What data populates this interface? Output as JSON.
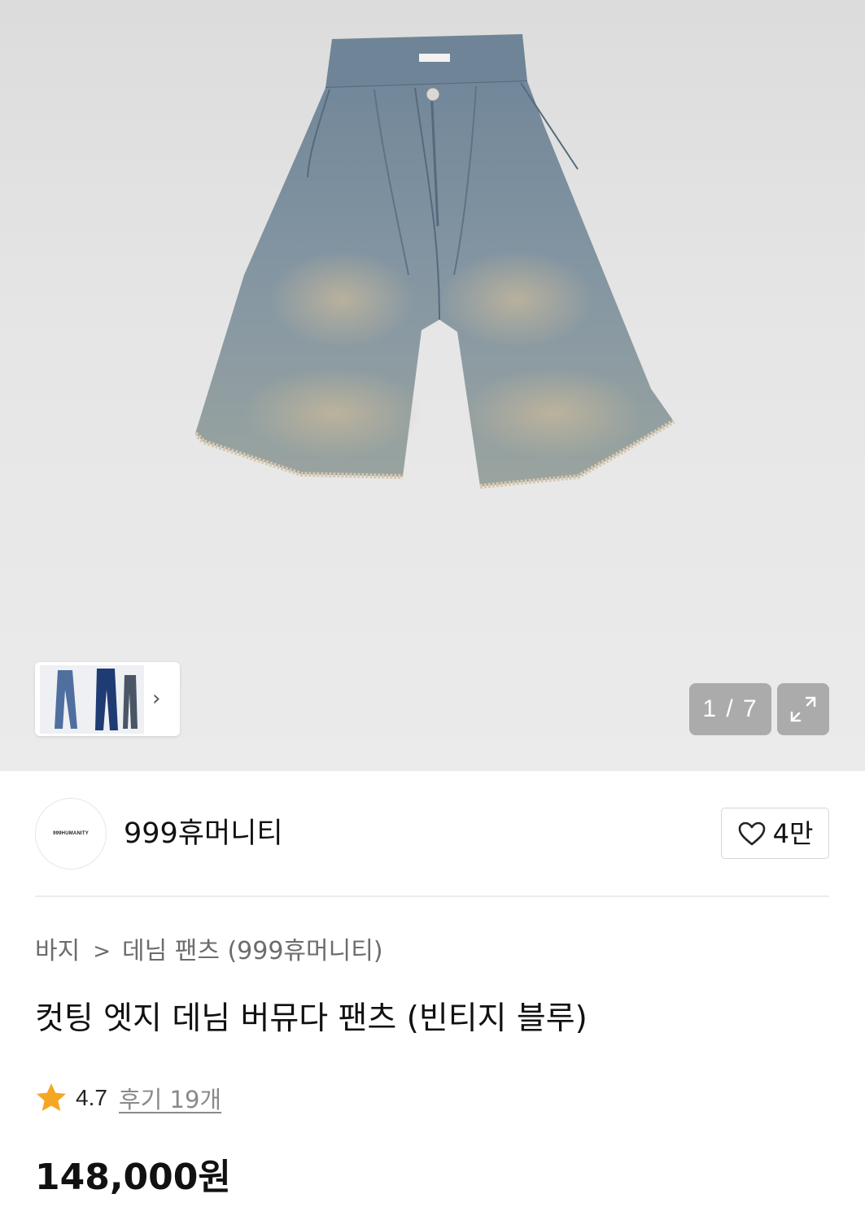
{
  "gallery": {
    "counter": "1 / 7",
    "image_icon": "denim-shorts-product-photo",
    "thumbnail_icon": "color-variant-thumbnails",
    "expand_icon": "expand-arrows-icon"
  },
  "brand": {
    "name": "999휴머니티",
    "logo_text": "999HUMANITY",
    "likes": "4만"
  },
  "breadcrumb": {
    "category": "바지",
    "subcategory": "데님 팬츠 (999휴머니티)"
  },
  "product": {
    "title": "컷팅 엣지 데님 버뮤다 팬츠 (빈티지 블루)",
    "rating": "4.7",
    "reviews": "후기 19개",
    "price": "148,000원"
  },
  "colors": {
    "star": "#f5a623",
    "denim": "#7f93a3"
  }
}
